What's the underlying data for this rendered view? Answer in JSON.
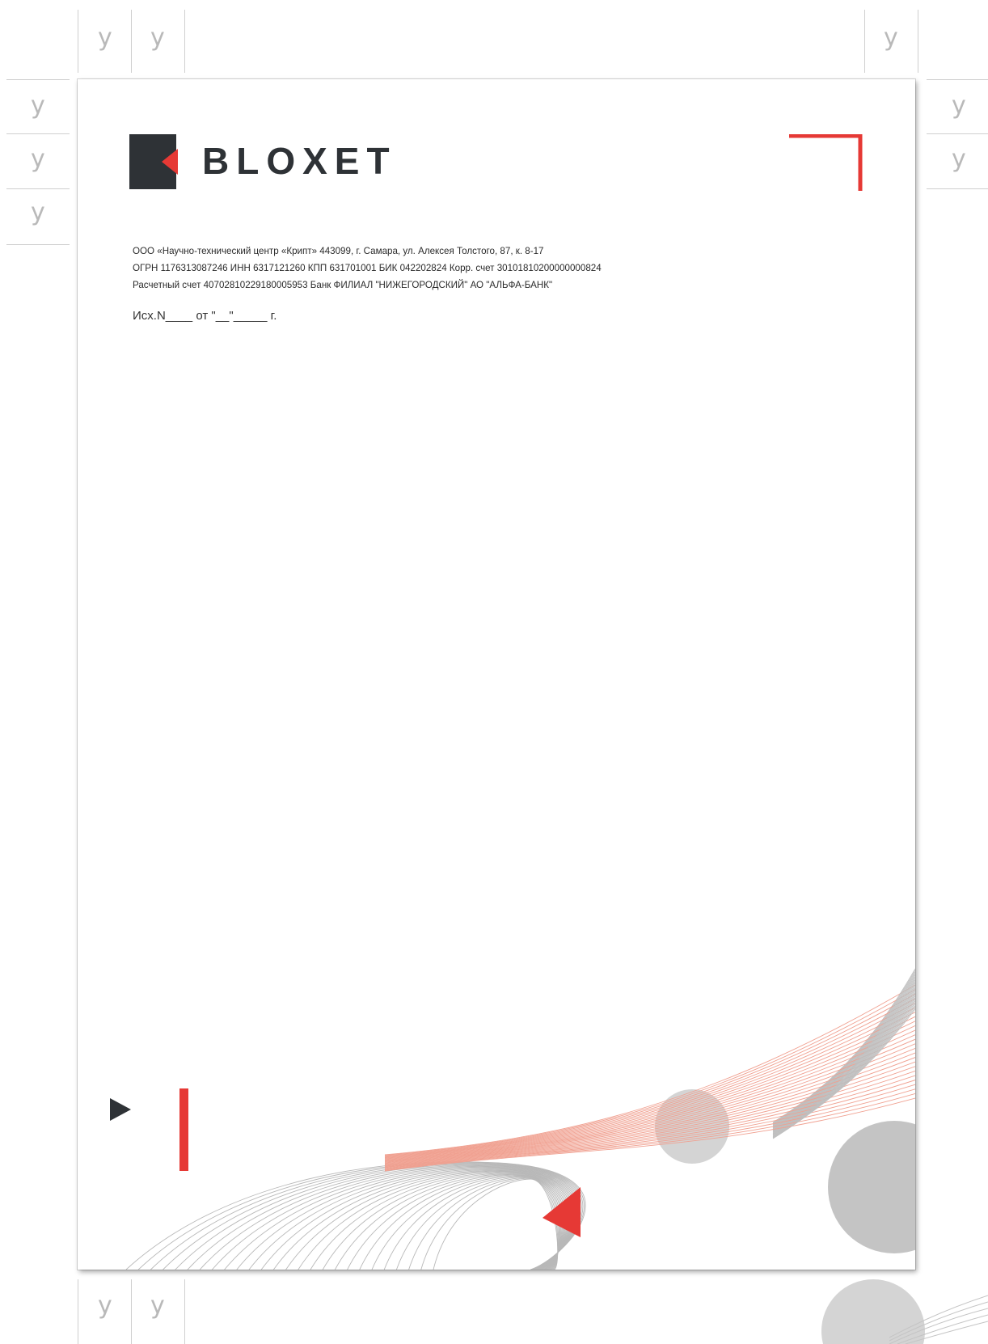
{
  "brand": {
    "name": "BLOXET",
    "colors": {
      "red": "#e63935",
      "dark": "#2e3236",
      "gray": "#c8c8c8"
    }
  },
  "requisites": [
    "ООО «Научно-технический центр «Крипт» 443099, г. Самара, ул. Алексея Толстого, 87, к. 8-17",
    "ОГРН 1176313087246  ИНН 6317121260 КПП 631701001 БИК 042202824 Корр. счет 30101810200000000824",
    "Расчетный счет 40702810229180005953 Банк ФИЛИАЛ \"НИЖЕГОРОДСКИЙ\" АО \"АЛЬФА-БАНК\""
  ],
  "outgoing_ref": "Исх.N____ от \"__\"_____ г.",
  "guide_mark": "у",
  "icons": [
    "logo-square-icon",
    "corner-bracket-icon",
    "play-triangle-icon",
    "red-bar-icon",
    "wave-lines-icon",
    "red-triangle-icon",
    "gray-circle-icon"
  ]
}
